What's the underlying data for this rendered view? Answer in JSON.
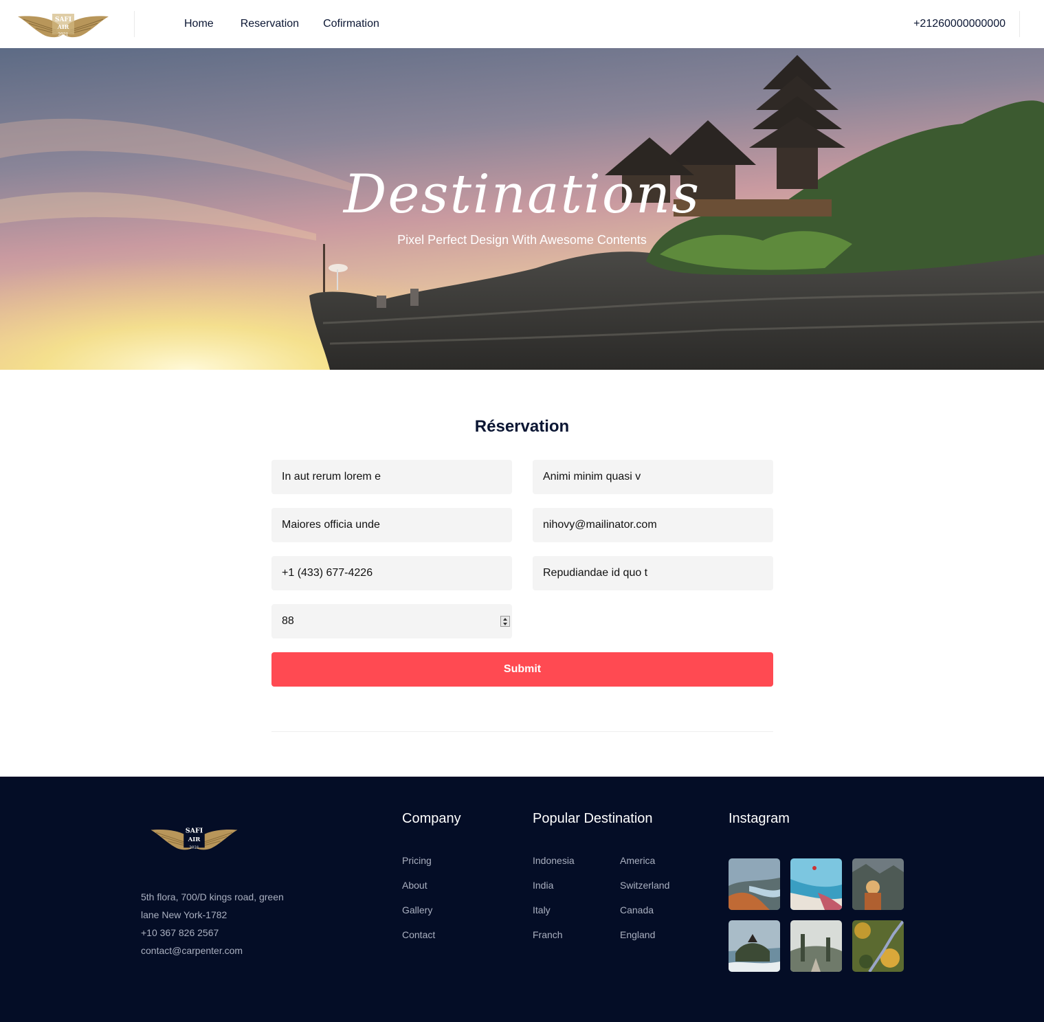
{
  "header": {
    "logo_text": "SAFI AIR 2021",
    "nav": [
      "Home",
      "Reservation",
      "Cofirmation"
    ],
    "phone": "+21260000000000"
  },
  "hero": {
    "title": "Destinations",
    "subtitle": "Pixel Perfect Design With Awesome Contents"
  },
  "reservation": {
    "title": "Réservation",
    "fields": [
      "In aut rerum lorem e",
      "Animi minim quasi v",
      "Maiores officia unde",
      "nihovy@mailinator.com",
      "+1 (433) 677-4226",
      "Repudiandae id quo t",
      "88"
    ],
    "submit_label": "Submit"
  },
  "footer": {
    "address": [
      "5th flora, 700/D kings road, green",
      "lane New York-1782",
      "+10 367 826 2567",
      "contact@carpenter.com"
    ],
    "company": {
      "heading": "Company",
      "links": [
        "Pricing",
        "About",
        "Gallery",
        "Contact"
      ]
    },
    "destinations": {
      "heading": "Popular Destination",
      "col1": [
        "Indonesia",
        "India",
        "Italy",
        "Franch"
      ],
      "col2": [
        "America",
        "Switzerland",
        "Canada",
        "England"
      ]
    },
    "instagram": {
      "heading": "Instagram"
    }
  },
  "colors": {
    "accent": "#ff4a52",
    "navy": "#040d26",
    "logo_gold": "#b8965a"
  }
}
